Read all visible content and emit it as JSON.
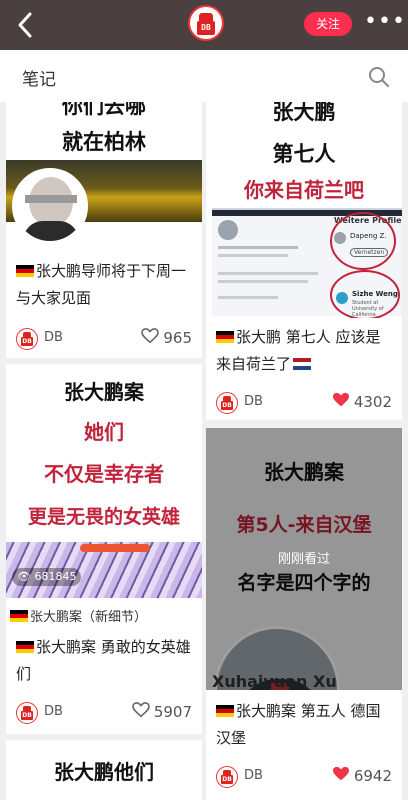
{
  "header": {
    "follow_label": "关注",
    "more_label": "•••",
    "avatar_text": "DB"
  },
  "notes_bar": {
    "label": "笔记"
  },
  "cards": [
    {
      "title_lines": [
        "你们去哪",
        "就在柏林"
      ],
      "description": "张大鹏导师将于下周一 与大家见面",
      "author": "DB",
      "likes": "965",
      "liked": false
    },
    {
      "title_lines": [
        "张大鹏",
        "第七人",
        "你来自荷兰吧"
      ],
      "screenshot_text": {
        "weitere": "Weitere Profile",
        "profile_name": "Dapeng Z.",
        "button": "Vernetzen",
        "profile2_name": "Sizhe Weng",
        "profile2_sub": "Student at University of California"
      },
      "description": "张大鹏 第七人 应该是来自荷兰了",
      "author": "DB",
      "likes": "4302",
      "liked": true
    },
    {
      "title_lines": [
        "张大鹏案",
        "她们",
        "不仅是幸存者",
        "更是无畏的女英雄"
      ],
      "view_count": "681845",
      "tag": "张大鹏案（新细节）",
      "description": "张大鹏案 勇敢的女英雄们",
      "author": "DB",
      "likes": "5907",
      "liked": false
    },
    {
      "title_lines": [
        "张大鹏案",
        "第5人-来自汉堡",
        "刚刚看过",
        "名字是四个字的"
      ],
      "bottom_text": "Xuhaiyuan Xu",
      "description": "张大鹏案 第五人 德国汉堡",
      "author": "DB",
      "likes": "6942",
      "liked": true
    },
    {
      "title_lines": [
        "张大鹏他们"
      ]
    }
  ],
  "colors": {
    "topbar": "#4a4040",
    "accent": "#ff2d4e",
    "title_red": "#c0233a"
  }
}
